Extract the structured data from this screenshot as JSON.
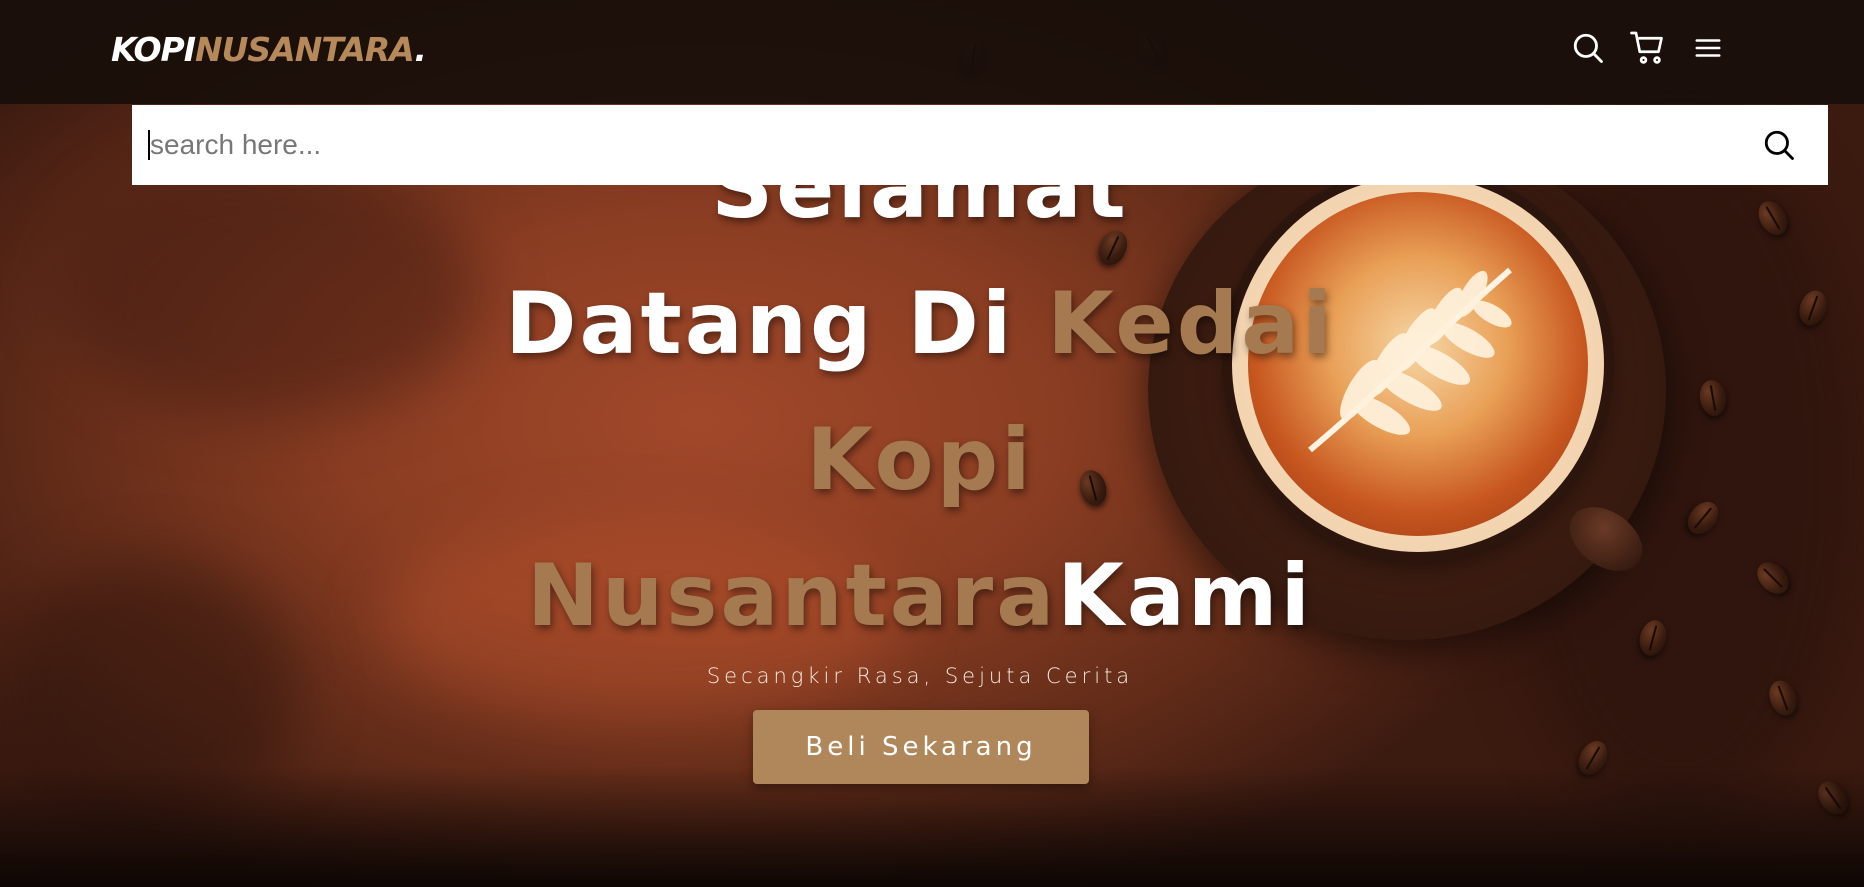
{
  "header": {
    "logo_main": "KOPI",
    "logo_accent": "NUSANTARA",
    "logo_dot": ".",
    "icons": [
      "search-icon",
      "cart-icon",
      "menu-icon"
    ]
  },
  "search": {
    "placeholder": "search here...",
    "value": "",
    "submit_icon": "search-icon"
  },
  "hero": {
    "line1": "Selamat",
    "line2_white": "Datang Di ",
    "line2_brown": "Kedai",
    "line3_brown": "Kopi",
    "line4_brown": "Nusantara",
    "line4_white": "Kami",
    "tagline": "Secangkir Rasa, Sejuta Cerita",
    "cta_label": "Beli Sekarang"
  },
  "colors": {
    "accent": "#b6895b",
    "header_bg": "#18100c",
    "cta_bg": "#b0875a",
    "text_white": "#ffffff"
  }
}
